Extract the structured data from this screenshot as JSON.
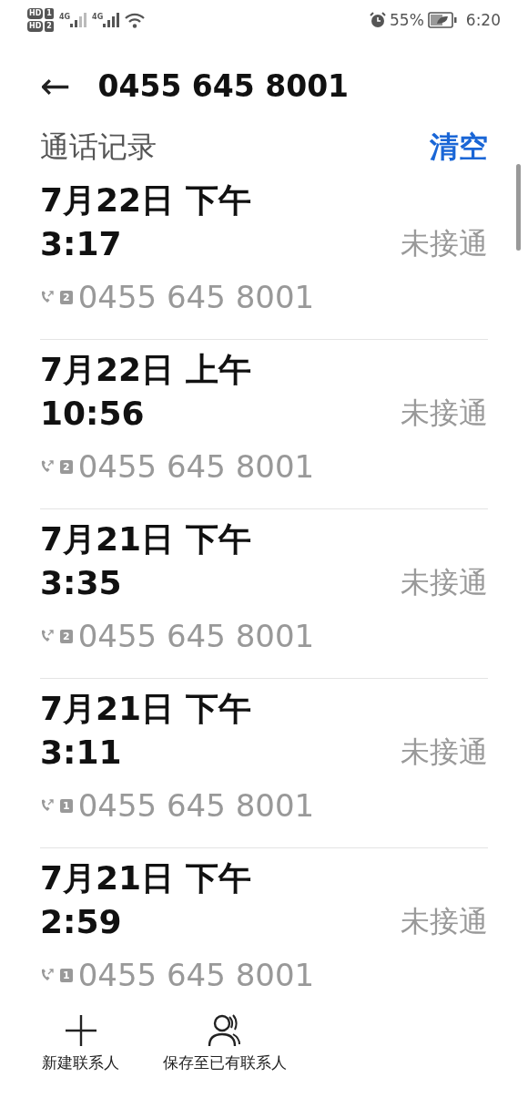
{
  "status_bar": {
    "sims": [
      {
        "hd": "HD",
        "slot": "1"
      },
      {
        "hd": "HD",
        "slot": "2"
      }
    ],
    "networks": [
      "4G",
      "4G"
    ],
    "battery": "55%",
    "time": "6:20"
  },
  "header": {
    "back": "←",
    "title": "0455 645 8001"
  },
  "section": {
    "title": "通话记录",
    "action": "清空"
  },
  "records": [
    {
      "date": "7月22日 下午",
      "time": "3:17",
      "status": "未接通",
      "sim": "2",
      "number": "0455 645 8001"
    },
    {
      "date": "7月22日 上午",
      "time": "10:56",
      "status": "未接通",
      "sim": "2",
      "number": "0455 645 8001"
    },
    {
      "date": "7月21日 下午",
      "time": "3:35",
      "status": "未接通",
      "sim": "2",
      "number": "0455 645 8001"
    },
    {
      "date": "7月21日 下午",
      "time": "3:11",
      "status": "未接通",
      "sim": "1",
      "number": "0455 645 8001"
    },
    {
      "date": "7月21日 下午",
      "time": "2:59",
      "status": "未接通",
      "sim": "1",
      "number": "0455 645 8001"
    }
  ],
  "actions": [
    {
      "kind": "add",
      "label": "新建联系人"
    },
    {
      "kind": "person",
      "label": "保存至已有联系人"
    }
  ]
}
